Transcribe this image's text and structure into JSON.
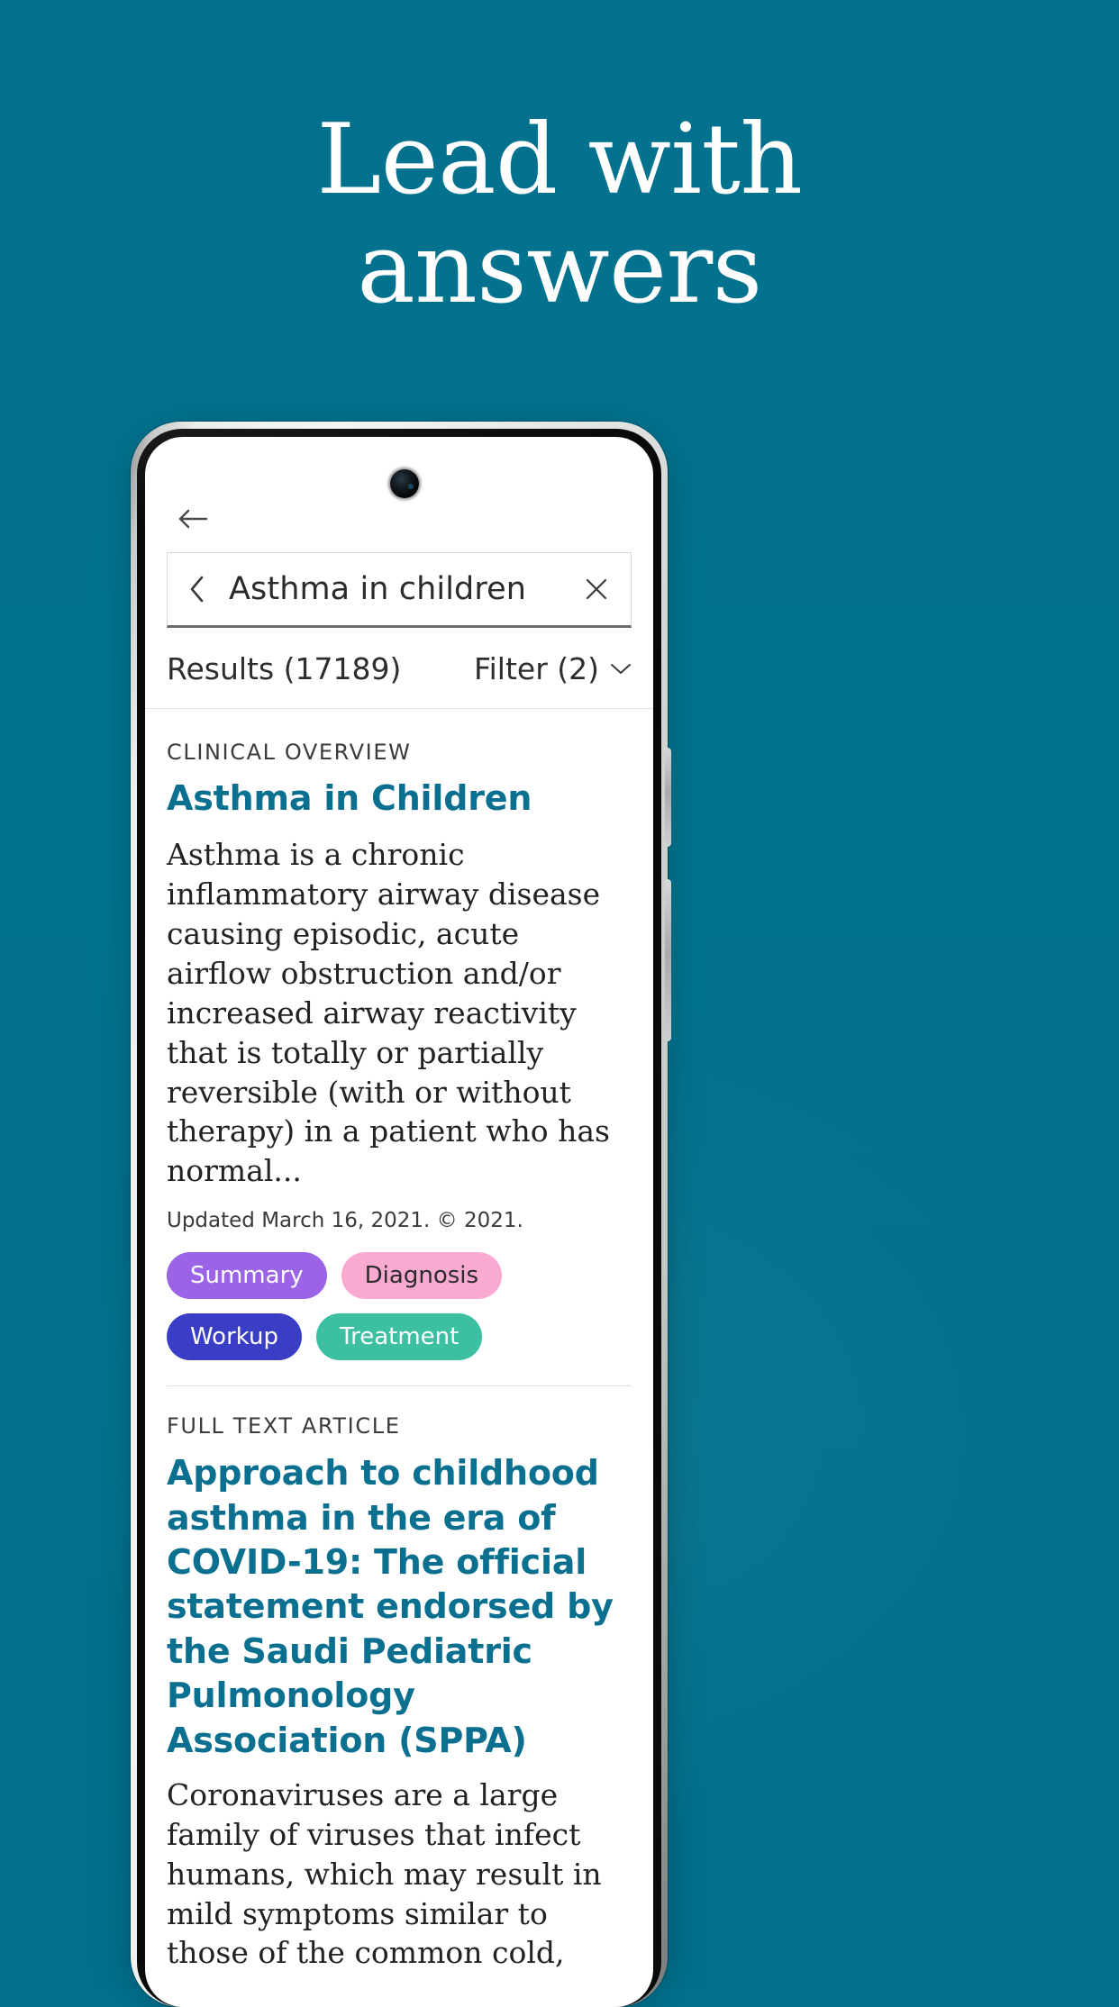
{
  "promo": {
    "headline_line1": "Lead with",
    "headline_line2": "answers",
    "background_color": "#02718f",
    "headline_color": "#ffffff"
  },
  "app": {
    "back_icon": "arrow-left-icon",
    "search": {
      "back_chevron_icon": "chevron-left-icon",
      "value": "Asthma in children",
      "placeholder": "Search",
      "clear_icon": "close-icon"
    },
    "results_bar": {
      "results_label": "Results (17189)",
      "filter_label": "Filter (2)",
      "filter_chevron_icon": "chevron-down-icon"
    },
    "results": [
      {
        "eyebrow": "CLINICAL OVERVIEW",
        "title": "Asthma in Children",
        "snippet": "Asthma is a chronic inflammatory airway disease causing episodic, acute airflow obstruction and/or increased airway reactivity that is totally or partially reversible (with or without therapy) in a patient who has normal...",
        "meta": "Updated March 16, 2021. © 2021.",
        "pills": [
          {
            "label": "Summary",
            "bg": "#9b63e6",
            "fg": "#ffffff"
          },
          {
            "label": "Diagnosis",
            "bg": "#f9aad0",
            "fg": "#2b2b2b"
          },
          {
            "label": "Workup",
            "bg": "#3a3ec4",
            "fg": "#ffffff"
          },
          {
            "label": "Treatment",
            "bg": "#3dbfa2",
            "fg": "#ffffff"
          }
        ]
      },
      {
        "eyebrow": "FULL TEXT ARTICLE",
        "title": "Approach to childhood asthma in the era of COVID-19: The official statement endorsed by the Saudi Pediatric Pulmonology Association (SPPA)",
        "snippet": "Coronaviruses are a large family of viruses that infect humans, which may result in mild symptoms similar to those of the common cold,",
        "meta": "",
        "pills": []
      }
    ],
    "accent_color": "#0b7090"
  }
}
